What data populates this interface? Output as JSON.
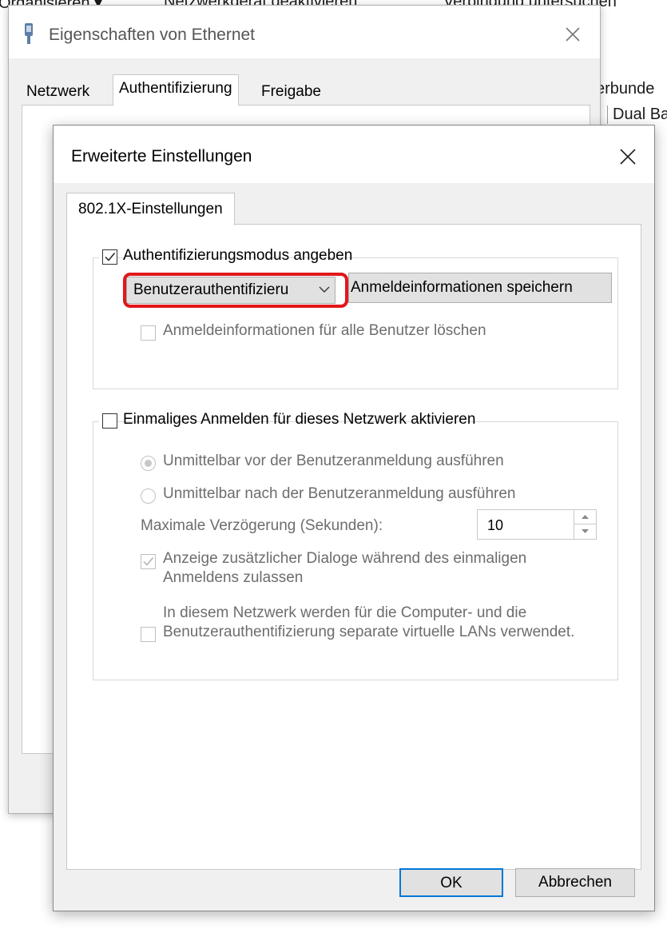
{
  "background": {
    "menu_items": [
      "Organisieren ▾",
      "Netzwerkgerät deaktivieren",
      "Verbindung untersuchen"
    ],
    "right_lines": [
      "erbunde",
      "Dual Ba"
    ]
  },
  "props_window": {
    "title": "Eigenschaften von Ethernet",
    "icon": "ethernet-icon",
    "tabs": [
      "Netzwerk",
      "Authentifizierung",
      "Freigabe"
    ],
    "active_tab": "Authentifizierung"
  },
  "advanced_dialog": {
    "title": "Erweiterte Einstellungen",
    "tab": "802.1X-Einstellungen",
    "auth_group": {
      "checkbox_label": "Authentifizierungsmodus angeben",
      "checked": true,
      "mode_select_value": "Benutzerauthentifizieru",
      "save_credentials_button": "Anmeldeinformationen speichern",
      "clear_credentials_label": "Anmeldeinformationen für alle Benutzer löschen",
      "clear_credentials_checked": false,
      "highlight_color": "#e0171b"
    },
    "sso_group": {
      "checkbox_label": "Einmaliges Anmelden für dieses Netzwerk aktivieren",
      "checked": false,
      "radio_before": "Unmittelbar vor der Benutzeranmeldung ausführen",
      "radio_after": "Unmittelbar nach der Benutzeranmeldung ausführen",
      "delay_label": "Maximale Verzögerung (Sekunden):",
      "delay_value": "10",
      "dialogs_label": "Anzeige zusätzlicher Dialoge während des einmaligen Anmeldens zulassen",
      "dialogs_checked": true,
      "vlan_label": "In diesem Netzwerk werden für die Computer- und die Benutzerauthentifizierung separate virtuelle LANs verwendet.",
      "vlan_checked": false
    },
    "buttons": {
      "ok": "OK",
      "cancel": "Abbrechen"
    }
  }
}
